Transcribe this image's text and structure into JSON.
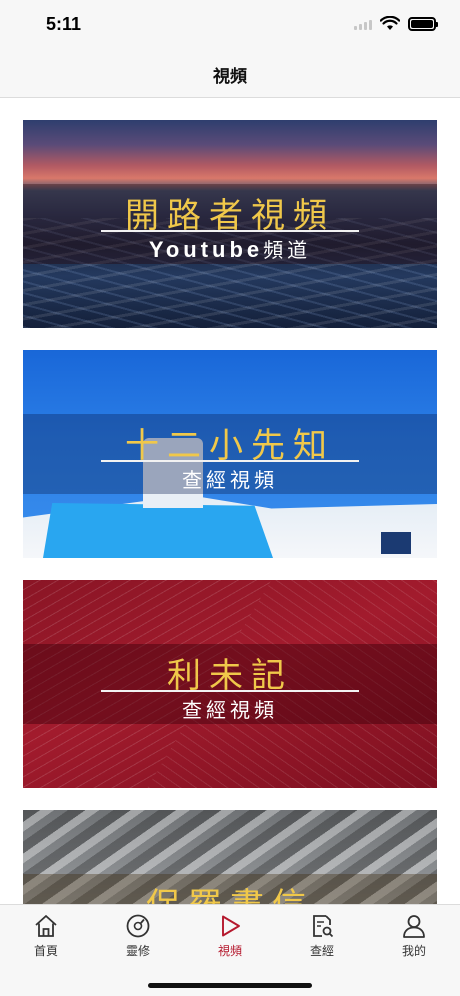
{
  "status": {
    "time": "5:11"
  },
  "nav": {
    "title": "視頻"
  },
  "cards": [
    {
      "title": "開路者視頻",
      "sub_prefix": "Youtube",
      "sub": "頻道"
    },
    {
      "title": "十二小先知",
      "sub_prefix": "",
      "sub": "查經視頻"
    },
    {
      "title": "利未記",
      "sub_prefix": "",
      "sub": "查經視頻"
    },
    {
      "title": "保羅書信",
      "sub_prefix": "",
      "sub": ""
    }
  ],
  "tabs": [
    {
      "label": "首頁",
      "icon": "home-icon"
    },
    {
      "label": "靈修",
      "icon": "compass-icon"
    },
    {
      "label": "視頻",
      "icon": "play-icon",
      "active": true
    },
    {
      "label": "查經",
      "icon": "search-document-icon"
    },
    {
      "label": "我的",
      "icon": "person-icon"
    }
  ],
  "colors": {
    "accent": "#b5182d",
    "title_gold": "#f0c84a"
  }
}
